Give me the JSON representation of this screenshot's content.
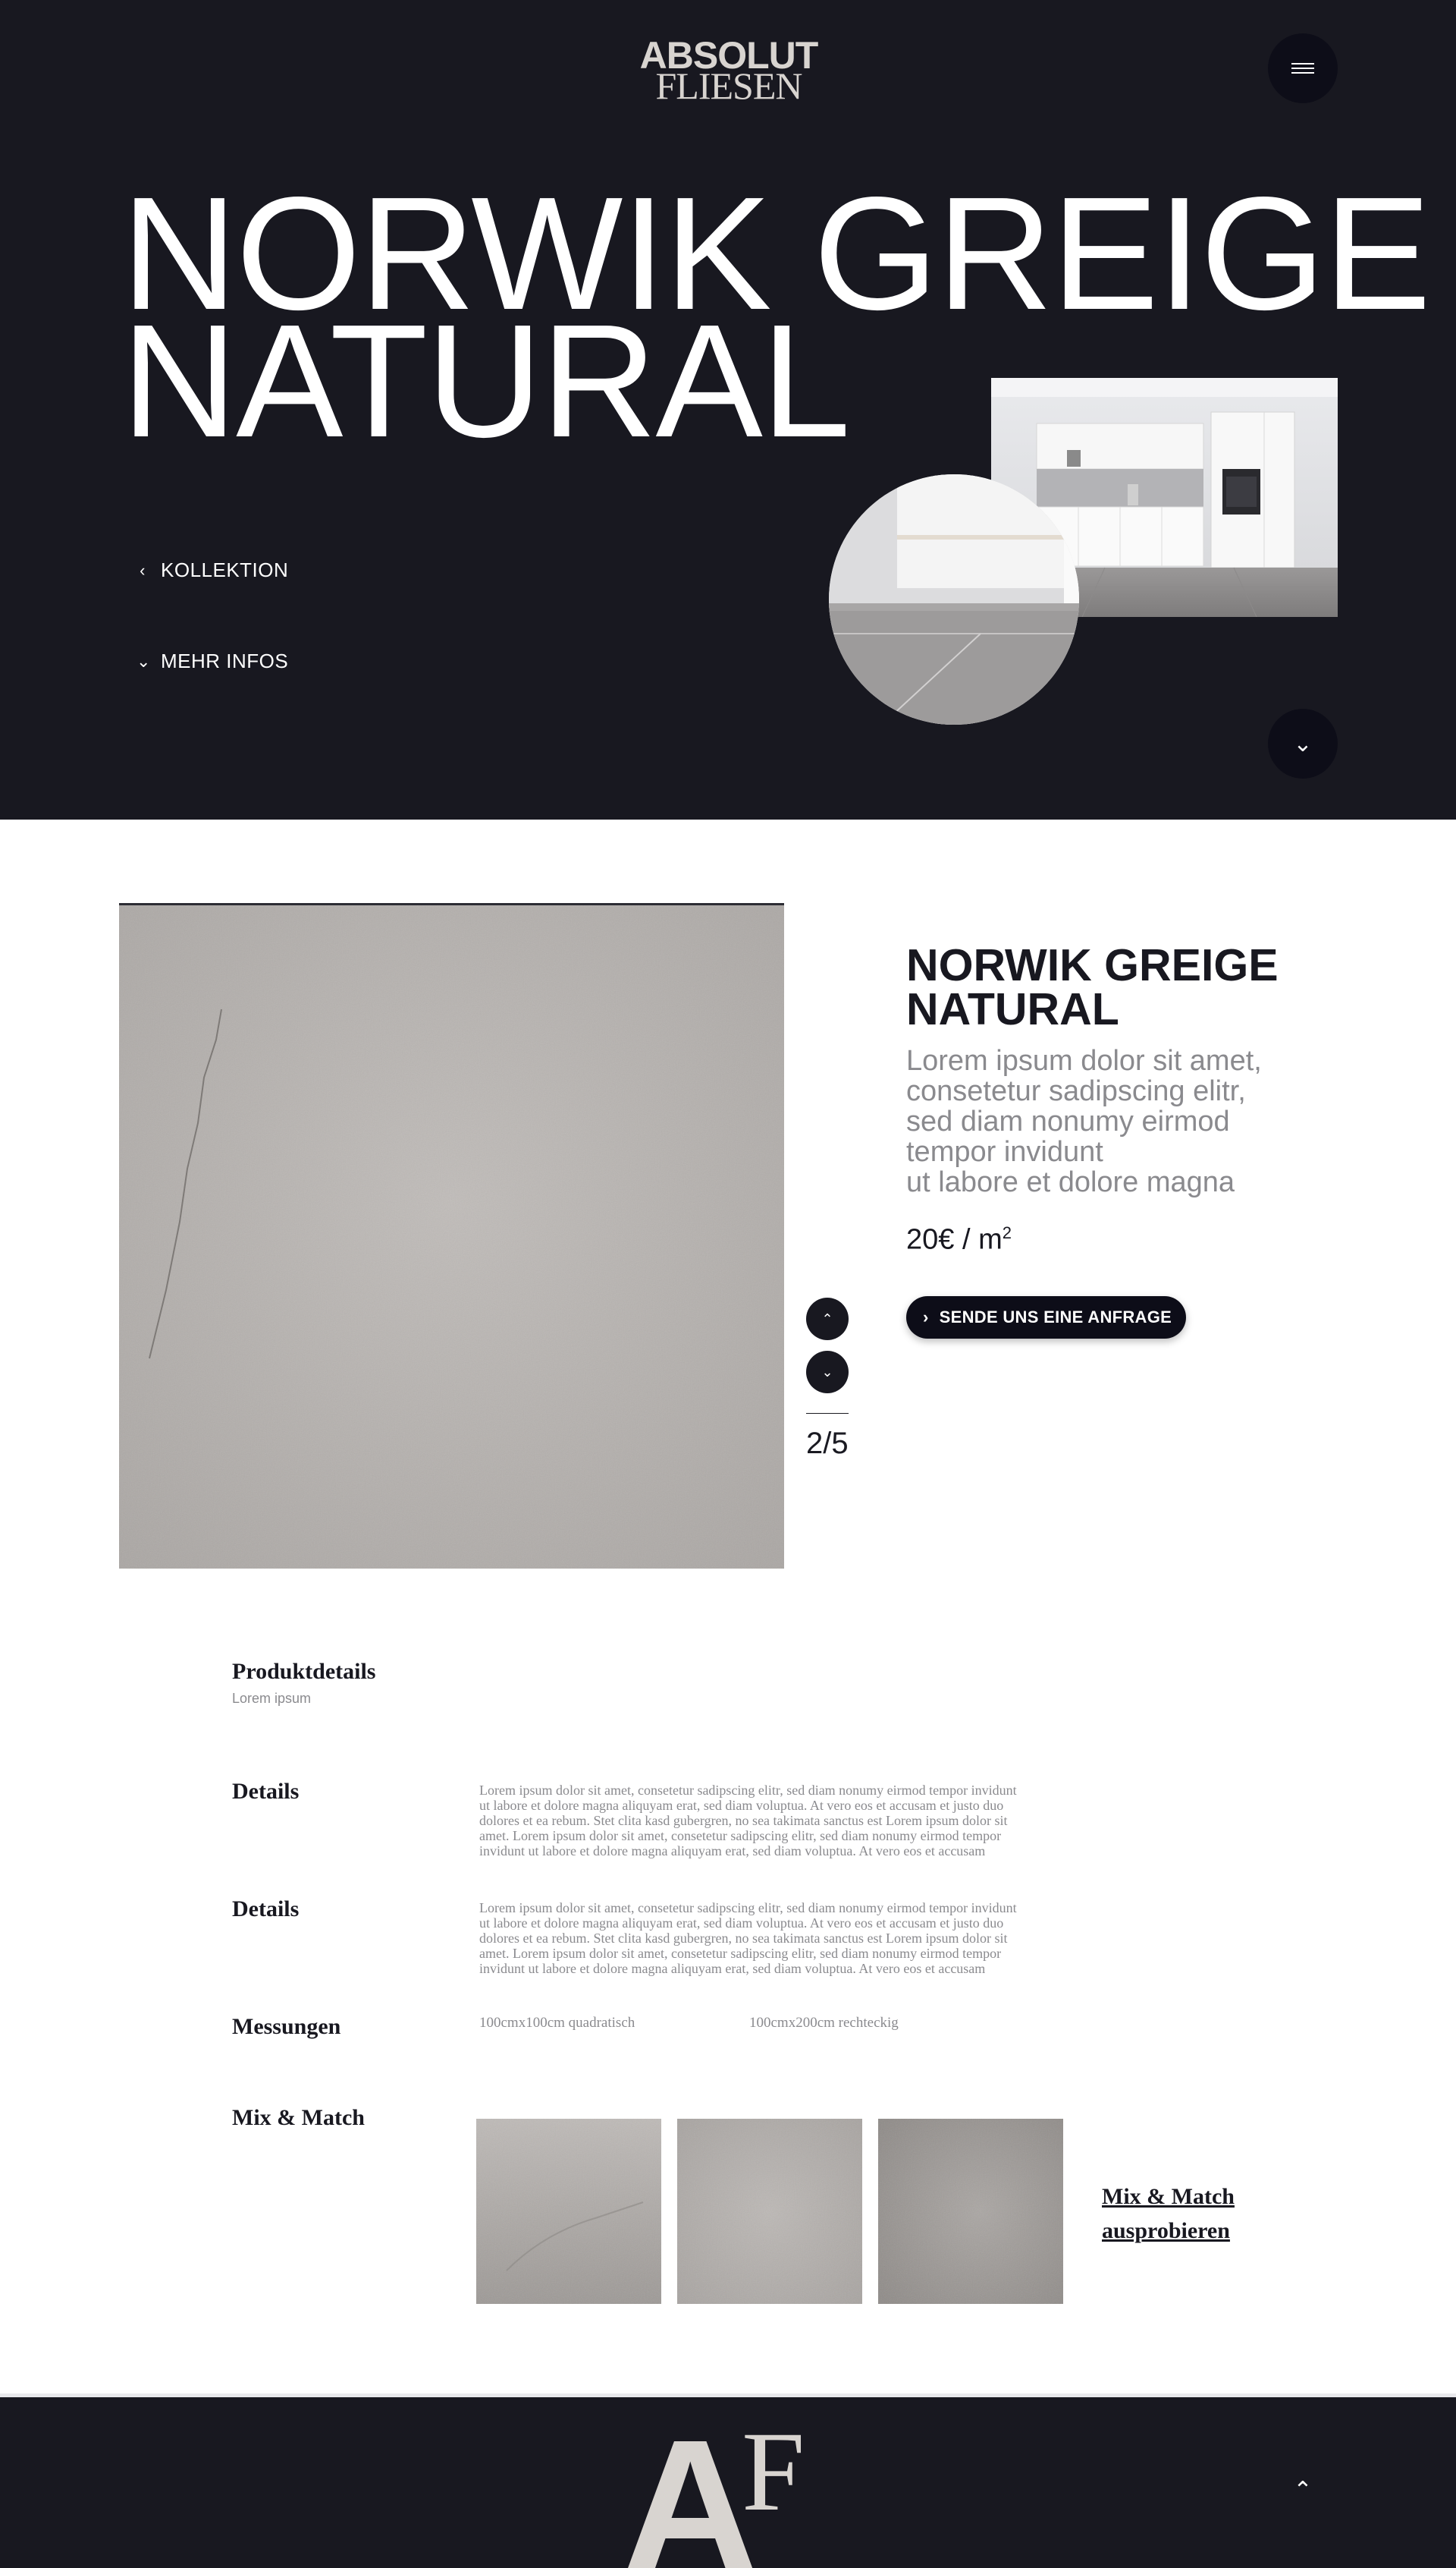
{
  "colors": {
    "dark_bg": "#181820",
    "button_bg": "#0d0d18",
    "muted_text": "#8a8a8e",
    "logo": "#d8d4d0"
  },
  "header": {
    "logo_line1": "ABSOLUT",
    "logo_line2": "FLIESEN",
    "menu_icon": "hamburger-icon"
  },
  "hero": {
    "title_line1": "NORWIK GREIGE",
    "title_line2": "NATURAL",
    "link_collection": "KOLLEKTION",
    "link_more": "MEHR INFOS",
    "scroll_icon": "chevron-down-icon"
  },
  "product": {
    "title_line1": "NORWIK GREIGE",
    "title_line2": "NATURAL",
    "description_lines": [
      "Lorem ipsum dolor sit amet,",
      "consetetur sadipscing elitr,",
      "sed diam nonumy eirmod",
      "tempor invidunt",
      "ut labore et dolore magna"
    ],
    "price": "20€ / m",
    "price_unit_sup": "2",
    "cta_label": "SENDE UNS EINE ANFRAGE",
    "gallery_counter": "2/5"
  },
  "details": {
    "heading": "Produktdetails",
    "subheading": "Lorem ipsum",
    "rows": [
      {
        "label": "Details",
        "text_lines": [
          "Lorem ipsum dolor sit amet, consetetur sadipscing elitr, sed diam nonumy eirmod tempor invidunt",
          "ut labore et dolore magna aliquyam erat, sed diam voluptua. At vero eos et accusam et justo duo",
          "dolores et ea rebum. Stet clita kasd gubergren, no sea takimata sanctus est Lorem ipsum dolor sit",
          "amet. Lorem ipsum dolor sit amet, consetetur sadipscing elitr, sed diam nonumy eirmod tempor",
          "invidunt ut labore et dolore magna aliquyam erat, sed diam voluptua. At vero eos et accusam"
        ]
      },
      {
        "label": "Details",
        "text_lines": [
          "Lorem ipsum dolor sit amet, consetetur sadipscing elitr, sed diam nonumy eirmod tempor invidunt",
          "ut labore et dolore magna aliquyam erat, sed diam voluptua. At vero eos et accusam et justo duo",
          "dolores et ea rebum. Stet clita kasd gubergren, no sea takimata sanctus est Lorem ipsum dolor sit",
          "amet. Lorem ipsum dolor sit amet, consetetur sadipscing elitr, sed diam nonumy eirmod tempor",
          "invidunt ut labore et dolore magna aliquyam erat, sed diam voluptua. At vero eos et accusam"
        ]
      }
    ],
    "measurements_label": "Messungen",
    "measurements": [
      "100cmx100cm quadratisch",
      "100cmx200cm rechteckig"
    ],
    "mix_label": "Mix & Match",
    "mix_link_line1": "Mix & Match",
    "mix_link_line2": "ausprobieren"
  },
  "footer": {
    "logo_letters": [
      "A",
      "F"
    ],
    "back_to_top_icon": "chevron-up-icon"
  }
}
